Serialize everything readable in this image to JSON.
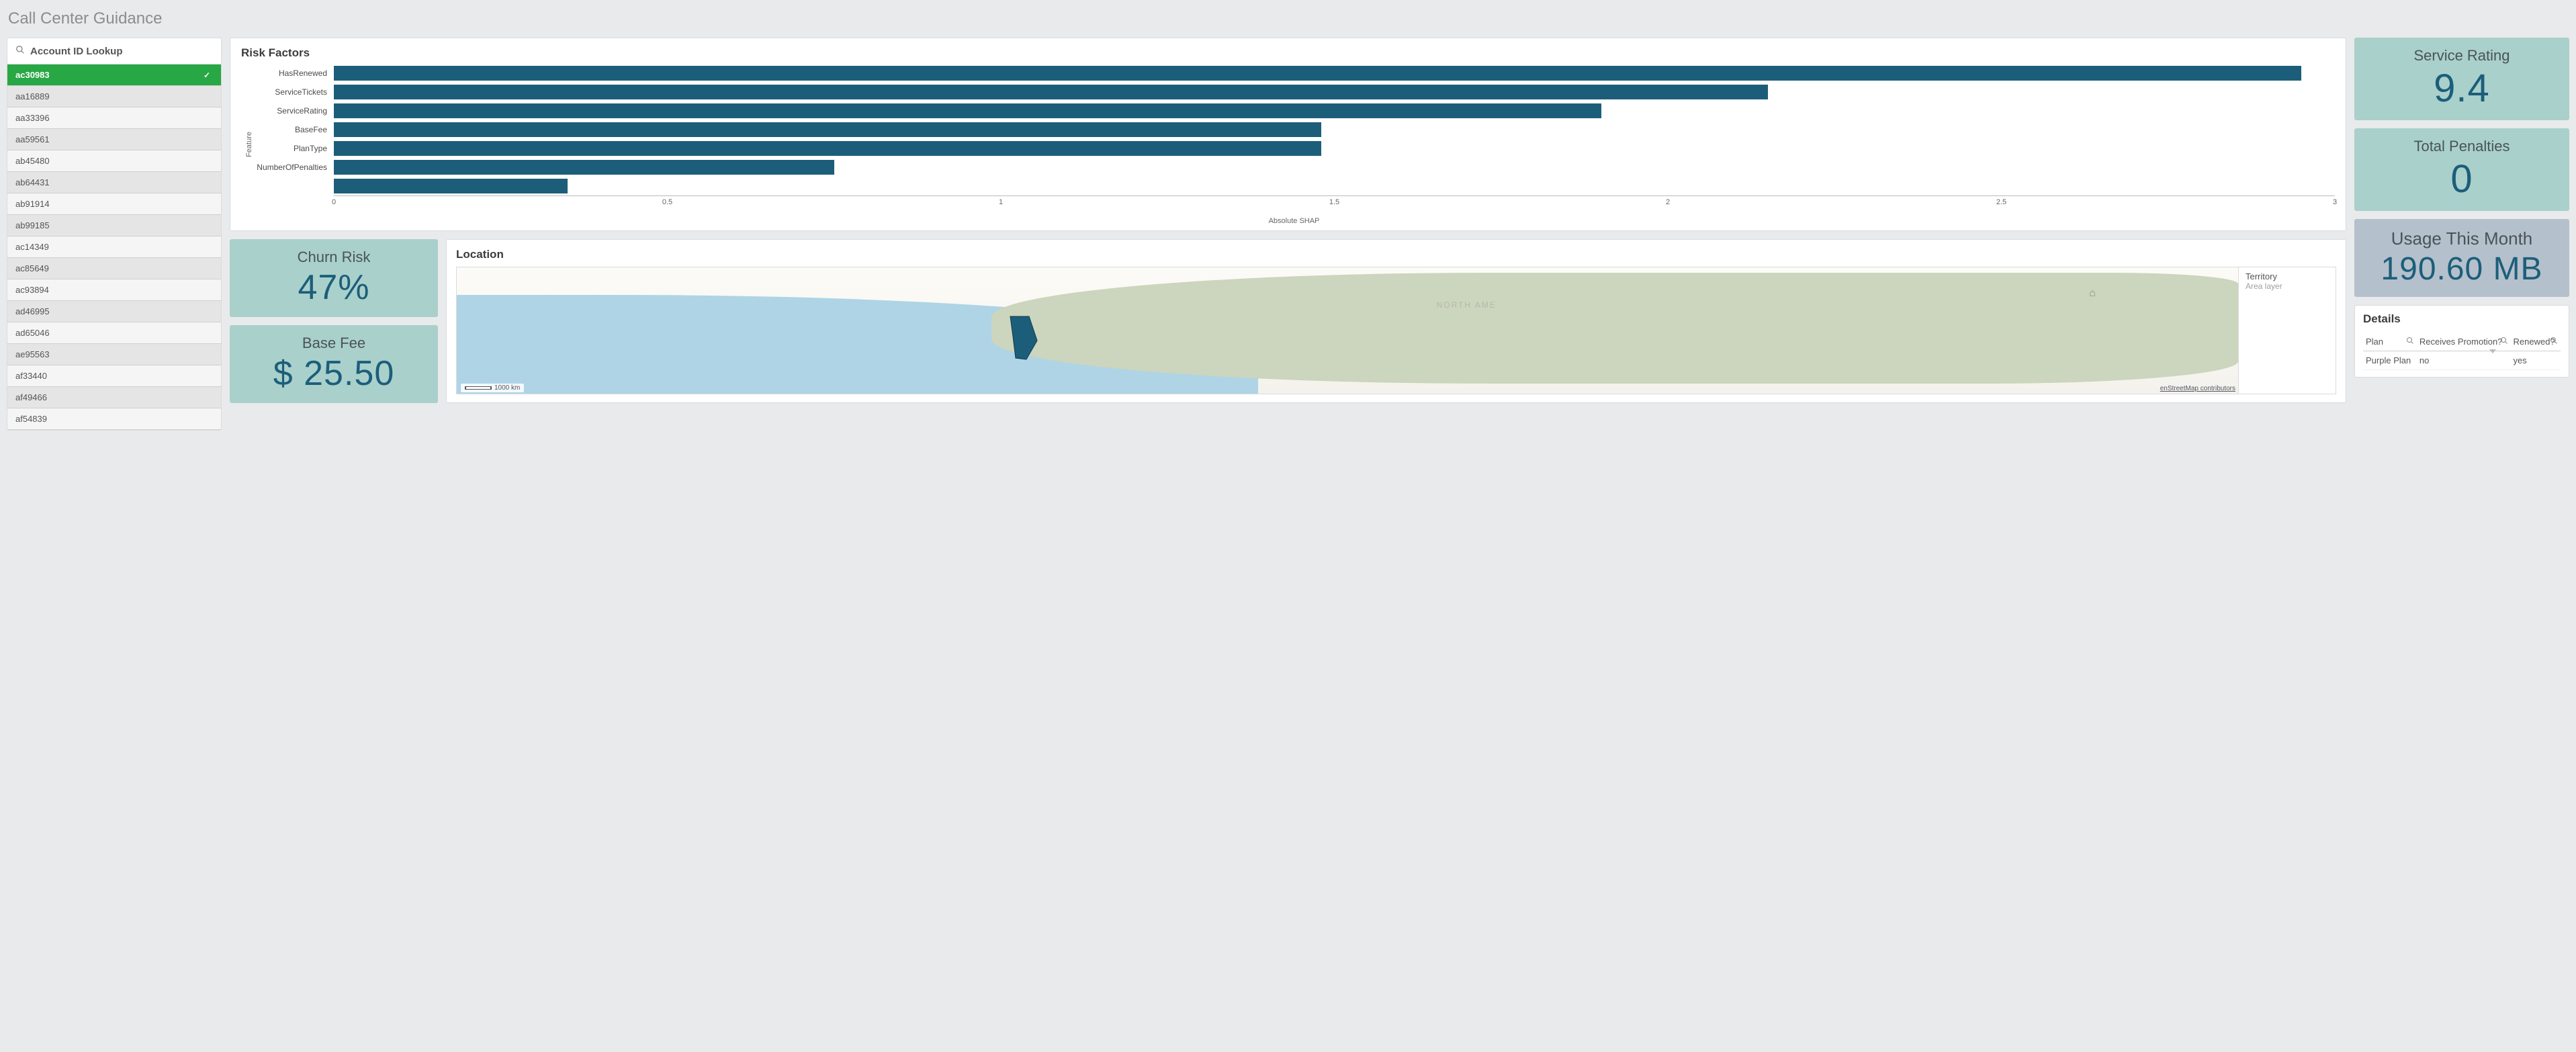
{
  "page_title": "Call Center Guidance",
  "lookup": {
    "label": "Account ID Lookup"
  },
  "accounts": {
    "selected_index": 0,
    "items": [
      "ac30983",
      "aa16889",
      "aa33396",
      "aa59561",
      "ab45480",
      "ab64431",
      "ab91914",
      "ab99185",
      "ac14349",
      "ac85649",
      "ac93894",
      "ad46995",
      "ad65046",
      "ae95563",
      "af33440",
      "af49466",
      "af54839"
    ]
  },
  "chart_data": {
    "type": "bar",
    "orientation": "horizontal",
    "title": "Risk Factors",
    "ylabel": "Feature",
    "xlabel": "Absolute SHAP",
    "xlim": [
      0,
      3
    ],
    "categories": [
      "HasRenewed",
      "ServiceTickets",
      "ServiceRating",
      "BaseFee",
      "PlanType",
      "NumberOfPenalties",
      ""
    ],
    "values": [
      2.95,
      2.15,
      1.9,
      1.48,
      1.48,
      0.75,
      0.35
    ]
  },
  "kpi": {
    "churn": {
      "label": "Churn Risk",
      "value": "47%"
    },
    "base_fee": {
      "label": "Base Fee",
      "value": "$ 25.50"
    },
    "service": {
      "label": "Service Rating",
      "value": "9.4"
    },
    "penalties": {
      "label": "Total Penalties",
      "value": "0"
    },
    "usage": {
      "label": "Usage This Month",
      "value": "190.60 MB"
    }
  },
  "map": {
    "title": "Location",
    "legend_title": "Territory",
    "legend_sub": "Area layer",
    "scale_label": "1000 km",
    "attribution": "enStreetMap contributors"
  },
  "details": {
    "title": "Details",
    "columns": [
      "Plan",
      "Receives Promotion?",
      "Renewed?"
    ],
    "rows": [
      {
        "plan": "Purple Plan",
        "promotion": "no",
        "renewed": "yes"
      }
    ]
  }
}
